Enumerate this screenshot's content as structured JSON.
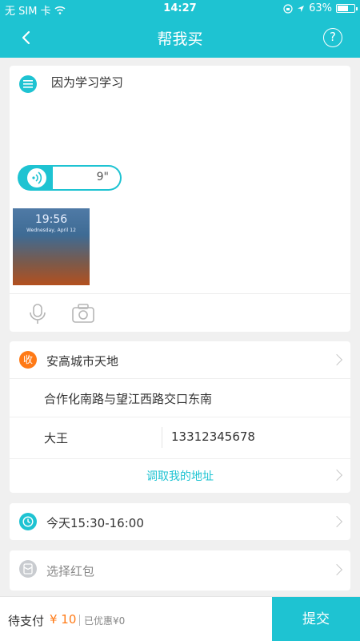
{
  "status_bar": {
    "carrier": "无 SIM 卡",
    "time": "14:27",
    "battery": "63%",
    "battery_level": 0.63
  },
  "nav": {
    "title": "帮我买",
    "help": "?"
  },
  "description": {
    "text": "因为学习学习",
    "voice_duration": "9\"",
    "photo_clock": "19:56",
    "photo_date": "Wednesday, April 12"
  },
  "address": {
    "badge": "收",
    "place": "安高城市天地",
    "detail": "合作化南路与望江西路交口东南",
    "name": "大王",
    "phone": "13312345678",
    "pick_link": "调取我的地址"
  },
  "time_slot": {
    "text": "今天15:30-16:00"
  },
  "redpacket": {
    "label": "选择红包"
  },
  "bottom": {
    "pay_label": "待支付",
    "pay_amount": "¥ 10",
    "discount": "已优惠¥0",
    "submit": "提交"
  }
}
